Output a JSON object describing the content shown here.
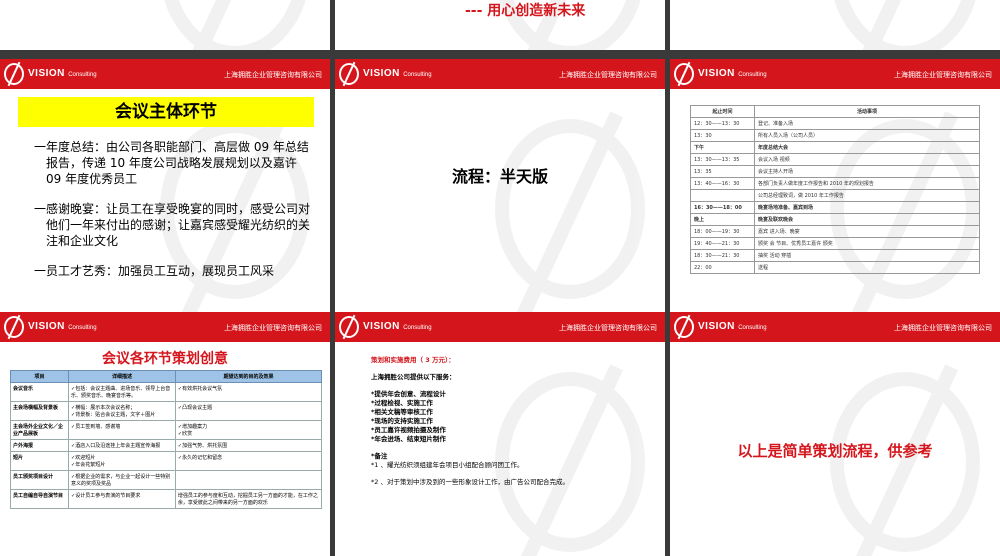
{
  "header": {
    "brand": "VISION",
    "brand_sub": "Consulting",
    "company": "上海拥胜企业管理咨询有限公司"
  },
  "top_slide": {
    "tagline": "--- 用心创造新未来"
  },
  "slide_main": {
    "title": "会议主体环节",
    "bullets": [
      "一年度总结：由公司各职能部门、高层做 09 年总结报告，传递 10 年度公司战略发展规划以及嘉许 09 年度优秀员工",
      "一感谢晚宴：让员工在享受晚宴的同时，感受公司对他们一年来付出的感谢；让嘉宾感受耀光纺织的关注和企业文化",
      "一员工才艺秀：加强员工互动，展现员工风采"
    ]
  },
  "slide_flow": {
    "title": "流程：半天版"
  },
  "schedule": {
    "headers": [
      "起止时间",
      "活动事项"
    ],
    "rows": [
      {
        "time": "12：30——13：30",
        "item": "登记、准备入场",
        "hl": false
      },
      {
        "time": "13：30",
        "item": "所有人员入场（公司人员）",
        "hl": false
      },
      {
        "time": "下午",
        "item": "年度总结大会",
        "hl": true
      },
      {
        "time": "13：30——13：35",
        "item": "会议入场 视频",
        "hl": false
      },
      {
        "time": "13：35",
        "item": "会议主持人开场",
        "hl": false
      },
      {
        "time": "13：40——16：30",
        "item": "各部门负责人做年度工作报告和 2010 年的规划报告",
        "hl": false
      },
      {
        "time": "",
        "item": "公司总经理致词，做 2010 年工作报告",
        "hl": false
      },
      {
        "time": "16：30——18：00",
        "item": "晚宴场地准备、嘉宾到场",
        "hl": true
      },
      {
        "time": "晚上",
        "item": "晚宴及联欢晚会",
        "hl": true
      },
      {
        "time": "18：00——19：30",
        "item": "嘉宾 进入场、晚宴",
        "hl": false
      },
      {
        "time": "19：40——21：30",
        "item": "颁奖 会 节目、优秀员工嘉许 颁奖",
        "hl": false
      },
      {
        "time": "18：30——21：30",
        "item": "抽奖 活动 穿插",
        "hl": false
      },
      {
        "time": "22：00",
        "item": "送程",
        "hl": false
      }
    ]
  },
  "plan": {
    "title": "会议各环节策划创意",
    "headers": [
      "项目",
      "详细描述",
      "期望达到的目的及效果"
    ],
    "rows": [
      {
        "item": "会议音乐",
        "desc": "✓包括：会议主题曲、进场音乐、领导上台音乐、颁奖音乐、晚宴音乐等。",
        "goal": "✓有效烘托会议气氛"
      },
      {
        "item": "主会场横幅及背景板",
        "desc": "✓横幅：展示本次会议名称；\n✓背景板：贴合会议主题，文字＋图片",
        "goal": "✓凸现会议主题"
      },
      {
        "item": "主会场外企业文化／企业产品展板",
        "desc": "✓员工签到墙、感谢墙",
        "goal": "✓增加趣案力\n✓欣赏"
      },
      {
        "item": "户外海报",
        "desc": "✓酒店入口及沿途挂上年会主题宣传海报",
        "goal": "✓加强气势、烘托氛围"
      },
      {
        "item": "短片",
        "desc": "✓欢迎短片\n✓年会花絮短片",
        "goal": "✓永久的记忆和留念"
      },
      {
        "item": "员工颁奖项目设计",
        "desc": "✓根据企业的需求，与企业一起设计一些特别意义的奖项及奖品",
        "goal": ""
      },
      {
        "item": "员工自编自导自演节目",
        "desc": "✓设计员工参与表演的节目要求",
        "goal": "增强员工的参与度和互动，挖掘员工另一方面的才能，在工作之余，享受彼此之间带来的另一方面的欢乐"
      }
    ]
  },
  "cost": {
    "title": "策划和实施费用（ 3 万元）：",
    "intro": "上海拥胜公司提供以下服务：",
    "services": [
      "*提供年会创意、流程设计",
      "*过程检视、实施工作",
      "*相关文稿等审核工作",
      "*现场的支持实施工作",
      "*员工嘉许视频拍摄及制作",
      "*年会进场、结束短片制作"
    ],
    "note_title": "*备注",
    "notes": [
      "*1 、耀光纺织须组建年会项目小组配合顾问团工作。",
      "*2 、对于策划中涉及到的一些形象设计工作，由广告公司配合完成。"
    ]
  },
  "final": {
    "text": "以上是简单策划流程，供参考"
  }
}
